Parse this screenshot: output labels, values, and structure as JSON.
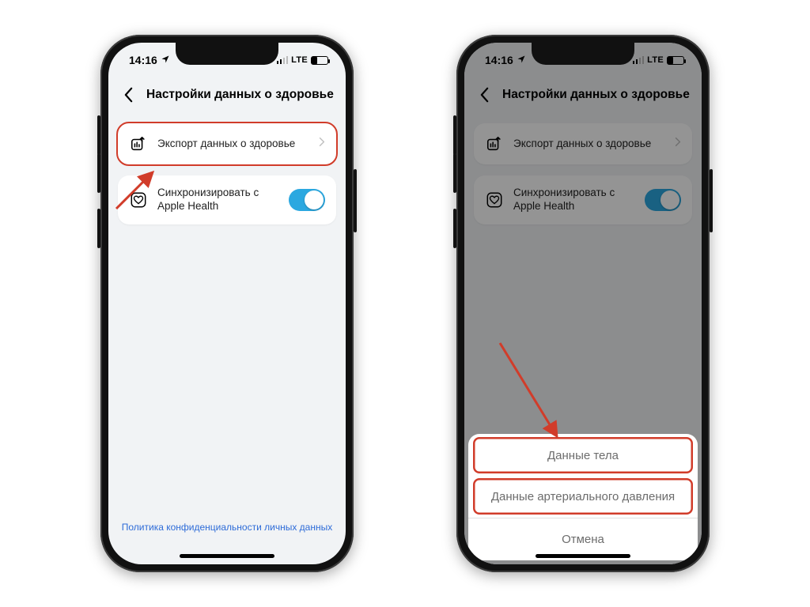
{
  "statusbar": {
    "time": "14:16",
    "network_label": "LTE"
  },
  "header": {
    "title": "Настройки данных о здоровье"
  },
  "rows": {
    "export_label": "Экспорт данных о здоровье",
    "sync_label": "Синхронизировать с Apple Health"
  },
  "footer": {
    "privacy_label": "Политика конфиденциальности личных данных"
  },
  "action_sheet": {
    "option_body": "Данные тела",
    "option_bp": "Данные артериального давления",
    "cancel": "Отмена"
  }
}
